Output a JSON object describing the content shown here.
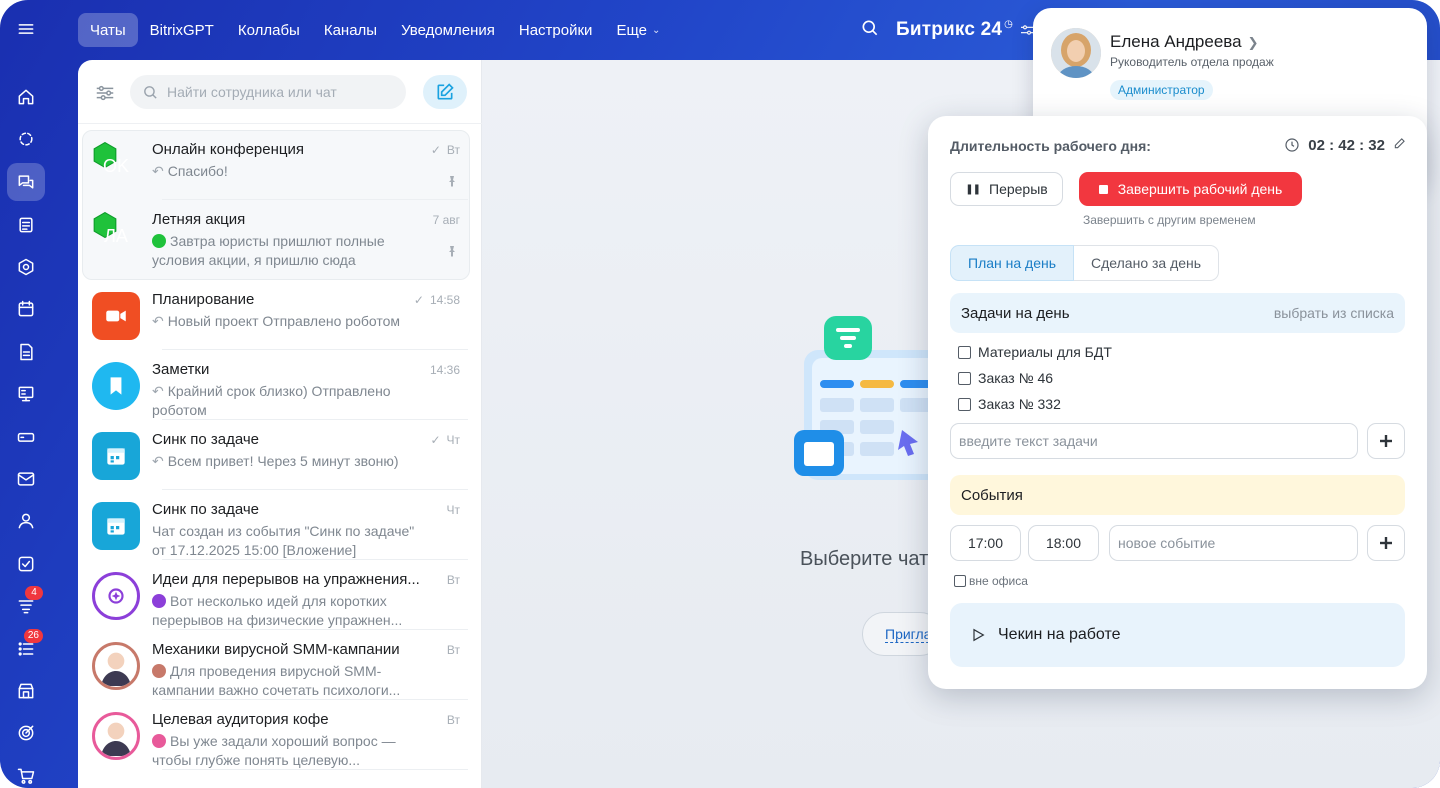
{
  "colors": {
    "accent": "#2145c8",
    "danger": "#f2373f",
    "link": "#1a7dc6",
    "badge_red": "#f0373e"
  },
  "rail": {
    "items": [
      {
        "icon": "menu-icon"
      },
      {
        "icon": "home-icon"
      },
      {
        "icon": "feed-icon"
      },
      {
        "icon": "chats-icon",
        "active": true
      },
      {
        "icon": "tasks-doc-icon"
      },
      {
        "icon": "hexagon-icon"
      },
      {
        "icon": "calendar-icon"
      },
      {
        "icon": "document-icon"
      },
      {
        "icon": "crm-board-icon"
      },
      {
        "icon": "drive-icon"
      },
      {
        "icon": "mail-icon"
      },
      {
        "icon": "contacts-icon"
      },
      {
        "icon": "checkbox-icon"
      },
      {
        "icon": "funnel-icon",
        "badge": "4"
      },
      {
        "icon": "list-icon",
        "badge": "26"
      },
      {
        "icon": "store-icon"
      },
      {
        "icon": "target-icon"
      },
      {
        "icon": "cart-icon"
      }
    ]
  },
  "topnav": {
    "items": [
      "Чаты",
      "BitrixGPT",
      "Коллабы",
      "Каналы",
      "Уведомления",
      "Настройки"
    ],
    "more": "Еще",
    "brand": "Битрикс 24"
  },
  "chatlist": {
    "search_placeholder": "Найти сотрудника или чат",
    "chats": [
      {
        "title": "Онлайн конференция",
        "time": "Вт",
        "check": true,
        "message": "Спасибо!",
        "reply": true,
        "pinned": true,
        "avatar_text": "OK",
        "avatar_color": "#1fc23b",
        "avatar_shape": "hex"
      },
      {
        "title": "Летняя акция",
        "time": "7 авг",
        "check": false,
        "message": "Завтра юристы пришлют полные условия акции, я пришлю сюда",
        "reply": false,
        "mini_avatar": true,
        "pinned": true,
        "avatar_text": "ЛА",
        "avatar_color": "#1fc23b",
        "avatar_shape": "hex"
      },
      {
        "title": "Планирование",
        "time": "14:58",
        "check": true,
        "message": "Новый проект Отправлено роботом",
        "reply": true,
        "avatar_icon": "video-icon",
        "avatar_color": "#f04e23",
        "avatar_shape": "rounded"
      },
      {
        "title": "Заметки",
        "time": "14:36",
        "check": false,
        "message": "Крайний срок близко) Отправлено роботом",
        "reply": true,
        "avatar_icon": "bookmark-icon",
        "avatar_color": "#1fb8f0",
        "avatar_shape": "circle"
      },
      {
        "title": "Синк по задаче",
        "time": "Чт",
        "check": true,
        "message": "Всем привет! Через 5 минут звоню)",
        "reply": true,
        "avatar_icon": "calendar-icon",
        "avatar_color": "#18a6d8",
        "avatar_shape": "rounded"
      },
      {
        "title": "Синк по задаче",
        "time": "Чт",
        "check": false,
        "message": "Чат создан из события \"Синк по задаче\" от 17.12.2025 15:00 [Вложение]",
        "reply": false,
        "avatar_icon": "calendar-icon",
        "avatar_color": "#18a6d8",
        "avatar_shape": "rounded"
      },
      {
        "title": "Идеи для перерывов на упражнения...",
        "time": "Вт",
        "check": false,
        "message": "Вот несколько идей для коротких перерывов на физические упражнен...",
        "reply": false,
        "mini_avatar": true,
        "avatar_icon": "ai-icon",
        "avatar_color": "#8c3fd9",
        "avatar_shape": "circle"
      },
      {
        "title": "Механики вирусной SMM-кампании",
        "time": "Вт",
        "check": false,
        "message": "Для проведения вирусной SMM-кампании важно сочетать психологи...",
        "reply": false,
        "mini_avatar": true,
        "avatar_icon": "person-photo-icon",
        "avatar_color": "#c7796a",
        "avatar_shape": "circle"
      },
      {
        "title": "Целевая аудитория кофе",
        "time": "Вт",
        "check": false,
        "message": "Вы уже задали хороший вопрос — чтобы глубже понять целевую...",
        "reply": false,
        "mini_avatar": true,
        "avatar_icon": "person-photo-icon",
        "avatar_color": "#e85a9a",
        "avatar_shape": "circle"
      }
    ]
  },
  "center": {
    "title": "Выберите чат",
    "invite": "Пригласить"
  },
  "profile": {
    "name": "Елена Андреева",
    "role": "Руководитель отдела продаж",
    "badge": "Администратор"
  },
  "worktime": {
    "duration_label": "Длительность рабочего дня:",
    "timer": "02 : 42 : 32",
    "pause": "Перерыв",
    "finish": "Завершить рабочий день",
    "finish_other": "Завершить с другим временем",
    "tabs": [
      "План на день",
      "Сделано за день"
    ],
    "tasks_title": "Задачи на день",
    "tasks_link": "выбрать из списка",
    "tasks": [
      "Материалы для БДТ",
      "Заказ № 46",
      "Заказ № 332"
    ],
    "task_placeholder": "введите текст задачи",
    "events_title": "События",
    "event_from": "17:00",
    "event_to": "18:00",
    "event_placeholder": "новое событие",
    "out_office": "вне офиса",
    "checkin": "Чекин на работе"
  }
}
